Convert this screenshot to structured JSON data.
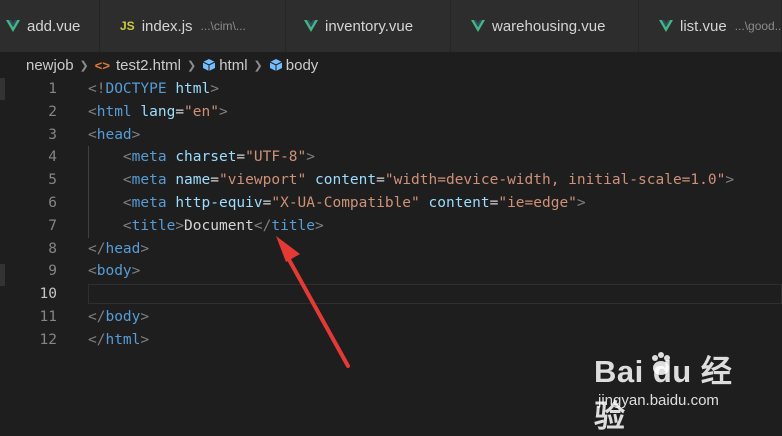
{
  "tabs": [
    {
      "label": "add.vue",
      "desc": "",
      "icon": "vue-icon"
    },
    {
      "label": "index.js",
      "desc": "...\\cim\\...",
      "icon": "js-icon"
    },
    {
      "label": "inventory.vue",
      "desc": "",
      "icon": "vue-icon"
    },
    {
      "label": "warehousing.vue",
      "desc": "",
      "icon": "vue-icon"
    },
    {
      "label": "list.vue",
      "desc": "...\\good...",
      "icon": "vue-icon"
    }
  ],
  "js_icon_text": "JS",
  "breadcrumb": {
    "folder": "newjob",
    "file": "test2.html",
    "file_icon_text": "<>",
    "symbols": [
      "html",
      "body"
    ]
  },
  "editor": {
    "active_line": 10,
    "line_numbers": [
      "1",
      "2",
      "3",
      "4",
      "5",
      "6",
      "7",
      "8",
      "9",
      "10",
      "11",
      "12"
    ],
    "lines": [
      {
        "indent": "",
        "tokens": [
          {
            "c": "t-punct",
            "t": "<!"
          },
          {
            "c": "t-tag",
            "t": "DOCTYPE"
          },
          {
            "c": "t-text",
            "t": " "
          },
          {
            "c": "t-attr",
            "t": "html"
          },
          {
            "c": "t-punct",
            "t": ">"
          }
        ]
      },
      {
        "indent": "",
        "tokens": [
          {
            "c": "t-punct",
            "t": "<"
          },
          {
            "c": "t-tag",
            "t": "html"
          },
          {
            "c": "t-text",
            "t": " "
          },
          {
            "c": "t-attr",
            "t": "lang"
          },
          {
            "c": "t-text",
            "t": "="
          },
          {
            "c": "t-str",
            "t": "\"en\""
          },
          {
            "c": "t-punct",
            "t": ">"
          }
        ]
      },
      {
        "indent": "",
        "tokens": [
          {
            "c": "t-punct",
            "t": "<"
          },
          {
            "c": "t-tag",
            "t": "head"
          },
          {
            "c": "t-punct",
            "t": ">"
          }
        ]
      },
      {
        "indent": "    ",
        "tokens": [
          {
            "c": "t-punct",
            "t": "<"
          },
          {
            "c": "t-tag",
            "t": "meta"
          },
          {
            "c": "t-text",
            "t": " "
          },
          {
            "c": "t-attr",
            "t": "charset"
          },
          {
            "c": "t-text",
            "t": "="
          },
          {
            "c": "t-str",
            "t": "\"UTF-8\""
          },
          {
            "c": "t-punct",
            "t": ">"
          }
        ]
      },
      {
        "indent": "    ",
        "tokens": [
          {
            "c": "t-punct",
            "t": "<"
          },
          {
            "c": "t-tag",
            "t": "meta"
          },
          {
            "c": "t-text",
            "t": " "
          },
          {
            "c": "t-attr",
            "t": "name"
          },
          {
            "c": "t-text",
            "t": "="
          },
          {
            "c": "t-str",
            "t": "\"viewport\""
          },
          {
            "c": "t-text",
            "t": " "
          },
          {
            "c": "t-attr",
            "t": "content"
          },
          {
            "c": "t-text",
            "t": "="
          },
          {
            "c": "t-str",
            "t": "\"width=device-width, initial-scale=1.0\""
          },
          {
            "c": "t-punct",
            "t": ">"
          }
        ]
      },
      {
        "indent": "    ",
        "tokens": [
          {
            "c": "t-punct",
            "t": "<"
          },
          {
            "c": "t-tag",
            "t": "meta"
          },
          {
            "c": "t-text",
            "t": " "
          },
          {
            "c": "t-attr",
            "t": "http-equiv"
          },
          {
            "c": "t-text",
            "t": "="
          },
          {
            "c": "t-str",
            "t": "\"X-UA-Compatible\""
          },
          {
            "c": "t-text",
            "t": " "
          },
          {
            "c": "t-attr",
            "t": "content"
          },
          {
            "c": "t-text",
            "t": "="
          },
          {
            "c": "t-str",
            "t": "\"ie=edge\""
          },
          {
            "c": "t-punct",
            "t": ">"
          }
        ]
      },
      {
        "indent": "    ",
        "tokens": [
          {
            "c": "t-punct",
            "t": "<"
          },
          {
            "c": "t-tag",
            "t": "title"
          },
          {
            "c": "t-punct",
            "t": ">"
          },
          {
            "c": "t-text",
            "t": "Document"
          },
          {
            "c": "t-punct",
            "t": "</"
          },
          {
            "c": "t-tag",
            "t": "title"
          },
          {
            "c": "t-punct",
            "t": ">"
          }
        ]
      },
      {
        "indent": "",
        "tokens": [
          {
            "c": "t-punct",
            "t": "</"
          },
          {
            "c": "t-tag",
            "t": "head"
          },
          {
            "c": "t-punct",
            "t": ">"
          }
        ]
      },
      {
        "indent": "",
        "tokens": [
          {
            "c": "t-punct",
            "t": "<"
          },
          {
            "c": "t-tag",
            "t": "body"
          },
          {
            "c": "t-punct",
            "t": ">"
          }
        ]
      },
      {
        "indent": "",
        "tokens": []
      },
      {
        "indent": "",
        "tokens": [
          {
            "c": "t-punct",
            "t": "</"
          },
          {
            "c": "t-tag",
            "t": "body"
          },
          {
            "c": "t-punct",
            "t": ">"
          }
        ]
      },
      {
        "indent": "",
        "tokens": [
          {
            "c": "t-punct",
            "t": "</"
          },
          {
            "c": "t-tag",
            "t": "html"
          },
          {
            "c": "t-punct",
            "t": ">"
          }
        ]
      }
    ]
  },
  "watermark": {
    "logo": "Bai du 经验",
    "site": "jingyan.baidu.com"
  },
  "colors": {
    "editor_bg": "#1e1e1e",
    "tab_bg": "#2d2d2d",
    "vue_green": "#41b883",
    "js_yellow": "#cbcb41",
    "html_orange": "#e37933",
    "annotation_arrow": "#e53935"
  }
}
